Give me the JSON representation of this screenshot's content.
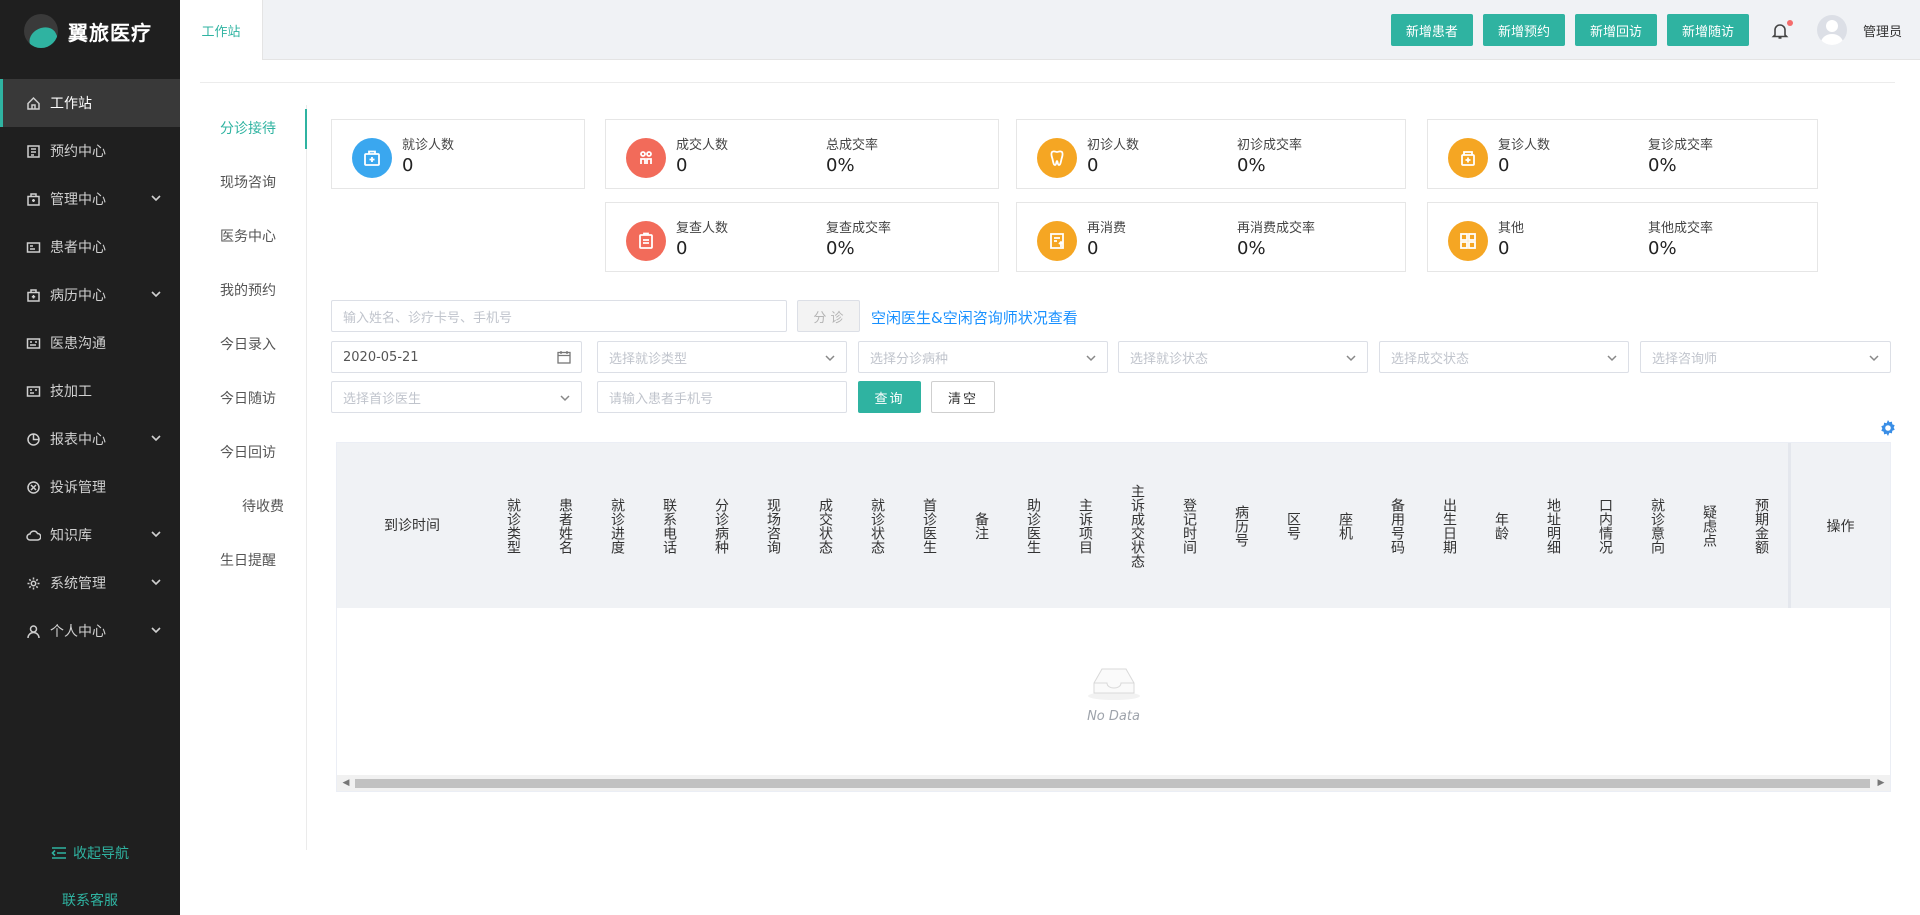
{
  "app": {
    "name": "翼旅医疗"
  },
  "sidebar": {
    "items": [
      {
        "label": "工作站",
        "icon": "home-icon",
        "active": true,
        "expandable": false
      },
      {
        "label": "预约中心",
        "icon": "calendar-book-icon",
        "active": false,
        "expandable": false
      },
      {
        "label": "管理中心",
        "icon": "briefcase-icon",
        "active": false,
        "expandable": true
      },
      {
        "label": "患者中心",
        "icon": "id-card-icon",
        "active": false,
        "expandable": false
      },
      {
        "label": "病历中心",
        "icon": "medical-case-icon",
        "active": false,
        "expandable": true
      },
      {
        "label": "医患沟通",
        "icon": "chat-card-icon",
        "active": false,
        "expandable": false
      },
      {
        "label": "技加工",
        "icon": "tool-card-icon",
        "active": false,
        "expandable": false
      },
      {
        "label": "报表中心",
        "icon": "pie-chart-icon",
        "active": false,
        "expandable": true
      },
      {
        "label": "投诉管理",
        "icon": "complaint-icon",
        "active": false,
        "expandable": false
      },
      {
        "label": "知识库",
        "icon": "cloud-icon",
        "active": false,
        "expandable": true
      },
      {
        "label": "系统管理",
        "icon": "gear-icon",
        "active": false,
        "expandable": true
      },
      {
        "label": "个人中心",
        "icon": "user-icon",
        "active": false,
        "expandable": true
      }
    ],
    "collapse_label": "收起导航",
    "contact_label": "联系客服"
  },
  "topbar": {
    "tab": "工作站",
    "actions": [
      "新增患者",
      "新增预约",
      "新增回访",
      "新增随访"
    ],
    "user": "管理员"
  },
  "subnav": {
    "items": [
      "分诊接待",
      "现场咨询",
      "医务中心",
      "我的预约",
      "今日录入",
      "今日随访",
      "今日回访",
      "待收费",
      "生日提醒"
    ],
    "active_index": 0
  },
  "stats": [
    {
      "icon": "medical-kit-icon",
      "color": "#3aa7ef",
      "items": [
        {
          "label": "就诊人数",
          "value": "0"
        }
      ]
    },
    {
      "icon": "handshake-icon",
      "color": "#f26b5a",
      "items": [
        {
          "label": "成交人数",
          "value": "0"
        },
        {
          "label": "总成交率",
          "value": "0%"
        }
      ]
    },
    {
      "icon": "tooth-icon",
      "color": "#f5a623",
      "items": [
        {
          "label": "初诊人数",
          "value": "0"
        },
        {
          "label": "初诊成交率",
          "value": "0%"
        }
      ]
    },
    {
      "icon": "medicine-bottle-icon",
      "color": "#f5a623",
      "items": [
        {
          "label": "复诊人数",
          "value": "0"
        },
        {
          "label": "复诊成交率",
          "value": "0%"
        }
      ]
    },
    {
      "icon": "clipboard-icon",
      "color": "#f26b5a",
      "items": [
        {
          "label": "复查人数",
          "value": "0"
        },
        {
          "label": "复查成交率",
          "value": "0%"
        }
      ]
    },
    {
      "icon": "bill-icon",
      "color": "#f5a623",
      "items": [
        {
          "label": "再消费",
          "value": "0"
        },
        {
          "label": "再消费成交率",
          "value": "0%"
        }
      ]
    },
    {
      "icon": "grid-icon",
      "color": "#f5a623",
      "items": [
        {
          "label": "其他",
          "value": "0"
        },
        {
          "label": "其他成交率",
          "value": "0%"
        }
      ]
    }
  ],
  "search": {
    "placeholder": "输入姓名、诊疗卡号、手机号",
    "triage_button": "分 诊",
    "status_link": "空闲医生&空闲咨询师状况查看"
  },
  "filters": {
    "date": "2020-05-21",
    "visit_type": "选择就诊类型",
    "triage_disease": "选择分诊病种",
    "visit_status": "选择就诊状态",
    "deal_status": "选择成交状态",
    "consultant": "选择咨询师",
    "first_doctor": "选择首诊医生",
    "phone_placeholder": "请输入患者手机号",
    "query": "查询",
    "clear": "清空"
  },
  "table": {
    "columns": [
      "到诊时间",
      "就诊类型",
      "患者姓名",
      "就诊进度",
      "联系电话",
      "分诊病种",
      "现场咨询",
      "成交状态",
      "就诊状态",
      "首诊医生",
      "备注",
      "助诊医生",
      "主诉项目",
      "主诉成交状态",
      "登记时间",
      "病历号",
      "区号",
      "座机",
      "备用号码",
      "出生日期",
      "年龄",
      "地址明细",
      "口内情况",
      "就诊意向",
      "疑虑点",
      "预期金额"
    ],
    "ops_column": "操作",
    "empty_text": "No Data"
  }
}
